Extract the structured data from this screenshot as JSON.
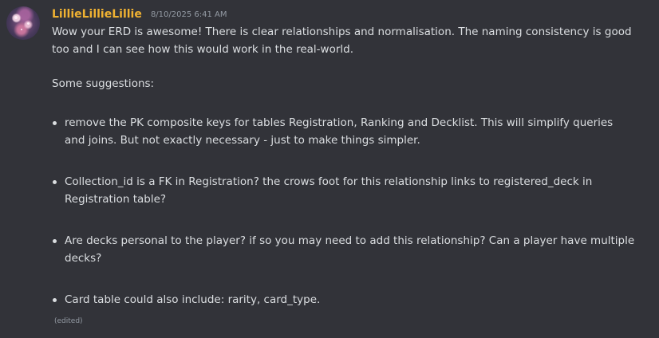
{
  "message": {
    "username": "LillieLillieLillie",
    "timestamp": "8/10/2025 6:41 AM",
    "intro_line1": "Wow your ERD is awesome! There is clear relationships and normalisation. The naming consistency is good",
    "intro_line2": "too and I can see how this would work in the real-world.",
    "suggestions_heading": "Some suggestions:",
    "bullets": [
      {
        "line1": "remove the PK composite keys for tables Registration, Ranking and Decklist. This will simplify queries",
        "line2": "and joins. But not exactly necessary - just to make things simpler."
      },
      {
        "line1": "Collection_id is a FK in Registration? the crows foot for this relationship links to registered_deck in",
        "line2": "Registration table?"
      },
      {
        "line1": "Are decks personal to the player? if so you may need to add this relationship? Can a player have multiple",
        "line2": "decks?"
      },
      {
        "line1": "Card table could also include: rarity, card_type."
      }
    ],
    "edited_label": "(edited)"
  },
  "colors": {
    "background": "#323339",
    "username": "#f0b232",
    "text": "#dbdee1",
    "muted": "#949ba4"
  },
  "icons": {
    "avatar": "user-avatar"
  }
}
